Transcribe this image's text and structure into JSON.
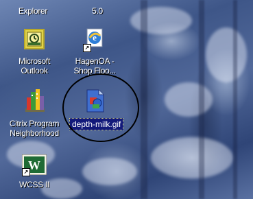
{
  "desktop": {
    "icons": [
      {
        "label": "Explorer",
        "icon": "internet-explorer-icon"
      },
      {
        "label": "5.0",
        "icon": "internet-explorer-icon"
      },
      {
        "label_line1": "Microsoft",
        "label_line2": "Outlook",
        "icon": "outlook-icon"
      },
      {
        "label_line1": "HagenOA -",
        "label_line2": "Shop Floo...",
        "icon": "internet-explorer-shortcut-icon"
      },
      {
        "label_line1": "Citrix Program",
        "label_line2": "Neighborhood",
        "icon": "citrix-icon"
      },
      {
        "label": "depth-milk.gif",
        "icon": "gif-image-icon",
        "selected": true
      },
      {
        "label": "WCSS II",
        "icon": "wcss-shortcut-icon"
      }
    ]
  }
}
